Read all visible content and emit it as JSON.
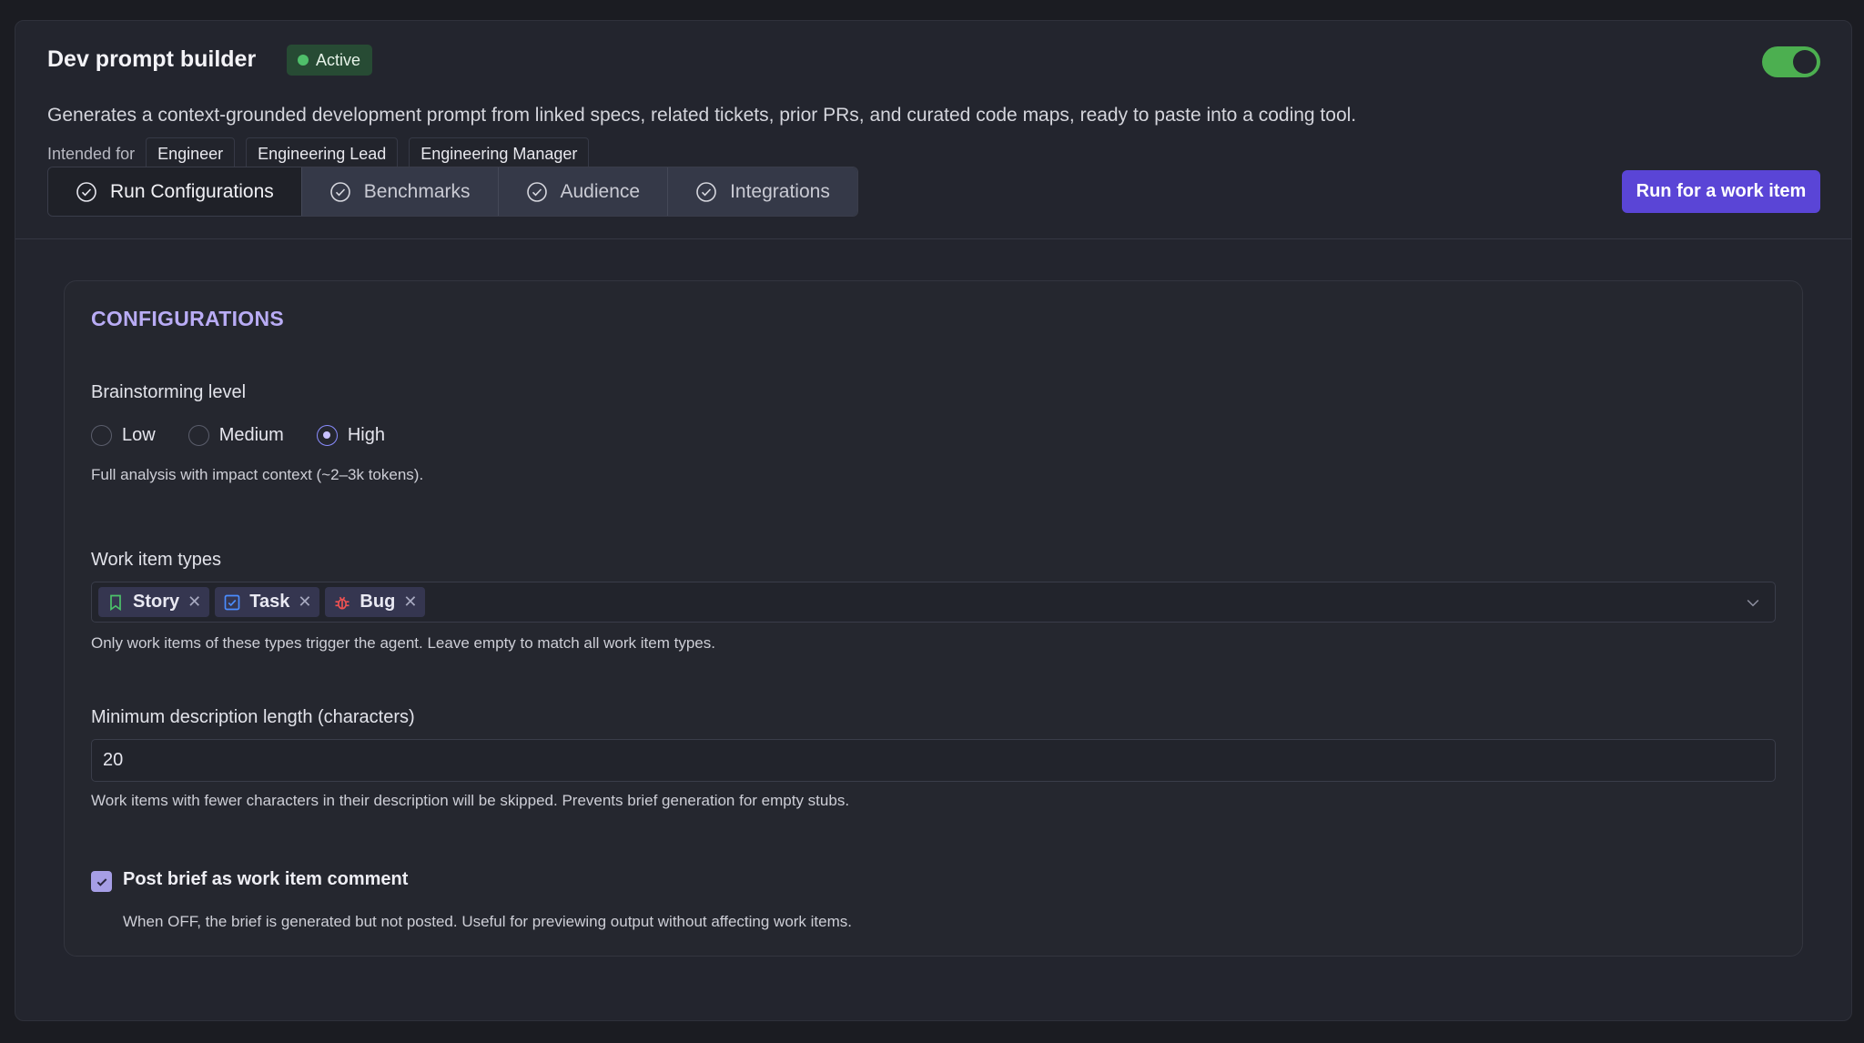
{
  "header": {
    "title": "Dev prompt builder",
    "status_badge": "Active",
    "enabled": true,
    "description": "Generates a context-grounded development prompt from linked specs, related tickets, prior PRs, and curated code maps, ready to paste into a coding tool.",
    "intended_label": "Intended for",
    "audiences": [
      "Engineer",
      "Engineering Lead",
      "Engineering Manager"
    ]
  },
  "tabs": [
    {
      "label": "Run Configurations",
      "icon": "check-circle-icon",
      "active": true
    },
    {
      "label": "Benchmarks",
      "icon": "check-circle-icon",
      "active": false
    },
    {
      "label": "Audience",
      "icon": "check-circle-icon",
      "active": false
    },
    {
      "label": "Integrations",
      "icon": "check-circle-icon",
      "active": false
    }
  ],
  "actions": {
    "run_label": "Run for a work item"
  },
  "config": {
    "section_title": "CONFIGURATIONS",
    "brainstorming": {
      "label": "Brainstorming level",
      "options": [
        "Low",
        "Medium",
        "High"
      ],
      "selected": "High",
      "help": "Full analysis with impact context (~2–3k tokens)."
    },
    "work_item_types": {
      "label": "Work item types",
      "tags": [
        {
          "label": "Story",
          "icon": "bookmark-icon"
        },
        {
          "label": "Task",
          "icon": "checkbox-icon"
        },
        {
          "label": "Bug",
          "icon": "bug-icon"
        }
      ],
      "help": "Only work items of these types trigger the agent. Leave empty to match all work item types."
    },
    "min_length": {
      "label": "Minimum description length (characters)",
      "value": "20",
      "help": "Work items with fewer characters in their description will be skipped. Prevents brief generation for empty stubs."
    },
    "post_comment": {
      "label": "Post brief as work item comment",
      "checked": true,
      "help": "When OFF, the brief is generated but not posted. Useful for previewing output without affecting work items."
    }
  },
  "colors": {
    "accent": "#5a45d6",
    "active_green": "#4caf50",
    "section_title": "#b9acf5",
    "background": "#1b1c22"
  }
}
